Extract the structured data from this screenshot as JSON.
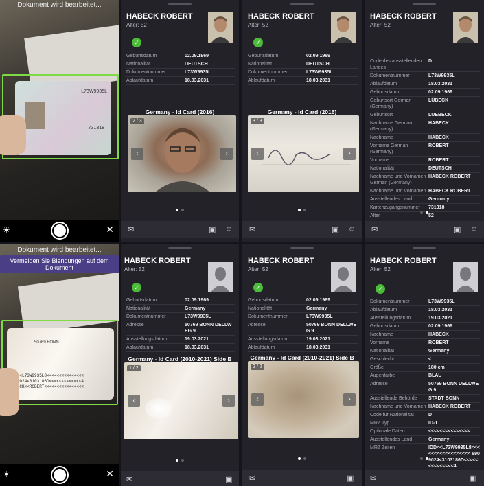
{
  "camera1": {
    "status": "Dokument wird bearbeitet...",
    "card_number": "L73W9935L",
    "card_code": "731318"
  },
  "camera2": {
    "status": "Dokument wird bearbeitet...",
    "warning": "Vermeiden Sie Blendungen auf dem Dokument",
    "mrz1": "IDD<<L73W9935L8<<<<<<<<<<<<<<<",
    "mrz2": "6909024<3103186D<<<<<<<<<<<<<4",
    "mrz3": "HABECK<<ROBERT<<<<<<<<<<<<<<<<",
    "address": "50769 BONN"
  },
  "panel1": {
    "name": "HABECK ROBERT",
    "age": "Alter: 52",
    "rows": [
      [
        "Geburtsdatum",
        "02.09.1969"
      ],
      [
        "Nationalität",
        "DEUTSCH"
      ],
      [
        "Dokumentnummer",
        "L73W9935L"
      ],
      [
        "Ablaufdatum",
        "18.03.2031"
      ]
    ],
    "title": "Germany - Id Card (2016)",
    "counter": "2 / 3"
  },
  "panel2": {
    "name": "HABECK ROBERT",
    "age": "Alter: 52",
    "rows": [
      [
        "Geburtsdatum",
        "02.09.1969"
      ],
      [
        "Nationalität",
        "DEUTSCH"
      ],
      [
        "Dokumentnummer",
        "L73W9935L"
      ],
      [
        "Ablaufdatum",
        "18.03.2031"
      ]
    ],
    "title": "Germany - Id Card (2016)",
    "counter": "3 / 3"
  },
  "panel3": {
    "name": "HABECK ROBERT",
    "age": "Alter: 52",
    "rows": [
      [
        "Code des ausstellenden Landes",
        "D"
      ],
      [
        "Dokumentnummer",
        "L73W9935L"
      ],
      [
        "Ablaufdatum",
        "18.03.2031"
      ],
      [
        "Geburtsdatum",
        "02.09.1969"
      ],
      [
        "Geburtsort German (Germany)",
        "LÜBECK"
      ],
      [
        "Geburtsort",
        "LUEBECK"
      ],
      [
        "Nachname German (Germany)",
        "HABECK"
      ],
      [
        "Nachname",
        "HABECK"
      ],
      [
        "Vorname German (Germany)",
        "ROBERT"
      ],
      [
        "Vorname",
        "ROBERT"
      ],
      [
        "Nationalität",
        "DEUTSCH"
      ],
      [
        "Nachname und Vornamen German (Germany)",
        "HABECK ROBERT"
      ],
      [
        "Nachname und Vornamen",
        "HABECK ROBERT"
      ],
      [
        "Ausstellendes Land",
        "Germany"
      ],
      [
        "Kartenzugangsnummer",
        "731318"
      ],
      [
        "Alter",
        "52"
      ]
    ]
  },
  "panel4": {
    "name": "HABECK ROBERT",
    "age": "Alter: 52",
    "rows": [
      [
        "Geburtsdatum",
        "02.09.1969"
      ],
      [
        "Nationalität",
        "Germany"
      ],
      [
        "Dokumentnummer",
        "L73W9935L"
      ],
      [
        "Adresse",
        "50769 BONN DELLWEG 9"
      ],
      [
        "Ausstellungsdatum",
        "19.03.2021"
      ],
      [
        "Ablaufdatum",
        "18.03.2031"
      ]
    ],
    "title": "Germany - Id Card (2010-2021) Side B",
    "counter": "1 / 2"
  },
  "panel5": {
    "name": "HABECK ROBERT",
    "age": "Alter: 52",
    "rows": [
      [
        "Geburtsdatum",
        "02.09.1969"
      ],
      [
        "Nationalität",
        "Germany"
      ],
      [
        "Dokumentnummer",
        "L73W9935L"
      ],
      [
        "Adresse",
        "50769 BONN DELLWEG 9"
      ],
      [
        "Ausstellungsdatum",
        "19.03.2021"
      ],
      [
        "Ablaufdatum",
        "18.03.2031"
      ]
    ],
    "title": "Germany - Id Card (2010-2021) Side B",
    "counter": "2 / 2"
  },
  "panel6": {
    "name": "HABECK ROBERT",
    "age": "Alter: 52",
    "rows": [
      [
        "Dokumentnummer",
        "L73W9935L"
      ],
      [
        "Ablaufdatum",
        "18.03.2031"
      ],
      [
        "Ausstellungsdatum",
        "19.03.2021"
      ],
      [
        "Geburtsdatum",
        "02.09.1969"
      ],
      [
        "Nachname",
        "HABECK"
      ],
      [
        "Vorname",
        "ROBERT"
      ],
      [
        "Nationalität",
        "Germany"
      ],
      [
        "Geschlecht",
        "<"
      ],
      [
        "Größe",
        "180 cm"
      ],
      [
        "Augenfarbe",
        "BLAU"
      ],
      [
        "Adresse",
        "50769 BONN DELLWEG 9"
      ],
      [
        "Ausstellende Behörde",
        "STADT BONN"
      ],
      [
        "Nachname und Vornamen",
        "HABECK ROBERT"
      ],
      [
        "Code für Nationalität",
        "D"
      ],
      [
        "MRZ Typ",
        "ID-1"
      ],
      [
        "Optionale Daten",
        "<<<<<<<<<<<<<<<"
      ],
      [
        "Ausstellendes Land",
        "Germany"
      ],
      [
        "MRZ Zeilen",
        "IDD<<L73W9935L8<<<<<<<<<<<<<<<<<< 6909024<3103186D<<<<<<<<<<<<<<4"
      ]
    ]
  }
}
